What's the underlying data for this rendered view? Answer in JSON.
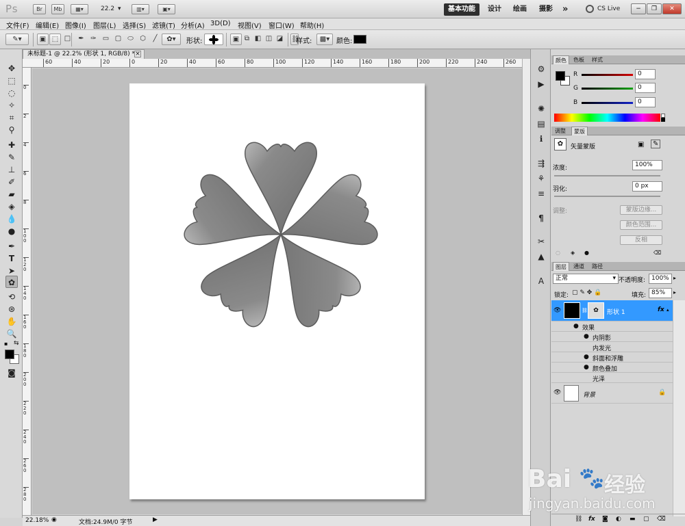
{
  "app": {
    "logo": "Ps",
    "br": "Br",
    "mb": "Mb",
    "zoom": "22.2"
  },
  "workspaces": {
    "active": "基本功能",
    "items": [
      "设计",
      "绘画",
      "摄影"
    ],
    "more": "»",
    "cslive": "CS Live"
  },
  "menu": [
    "文件(F)",
    "编辑(E)",
    "图像(I)",
    "图层(L)",
    "选择(S)",
    "滤镜(T)",
    "分析(A)",
    "3D(D)",
    "视图(V)",
    "窗口(W)",
    "帮助(H)"
  ],
  "options": {
    "shape_label": "形状:",
    "style_label": "样式:",
    "color_label": "颜色:",
    "color_value": "#000000"
  },
  "document": {
    "tab_title": "未标题-1 @ 22.2% (形状 1, RGB/8) *",
    "ruler_h": [
      "60",
      "40",
      "20",
      "0",
      "20",
      "40",
      "60",
      "80",
      "100",
      "120",
      "140",
      "160",
      "180",
      "200",
      "220",
      "240",
      "260"
    ],
    "ruler_v": [
      "0",
      "2",
      "4",
      "6",
      "8",
      "100",
      "120",
      "140",
      "160",
      "180",
      "200",
      "220",
      "240",
      "260",
      "280",
      "300"
    ],
    "zoom_status": "22.18%",
    "doc_status": "文档:24.9M/0 字节"
  },
  "color_panel": {
    "tabs": [
      "颜色",
      "色板",
      "样式"
    ],
    "channels": [
      {
        "label": "R",
        "value": "0",
        "color": "#d40000"
      },
      {
        "label": "G",
        "value": "0",
        "color": "#12a312"
      },
      {
        "label": "B",
        "value": "0",
        "color": "#1222c8"
      }
    ]
  },
  "mask_panel": {
    "tabs": [
      "调整",
      "蒙版"
    ],
    "title": "矢量蒙版",
    "density_label": "浓度:",
    "density_value": "100%",
    "feather_label": "羽化:",
    "feather_value": "0 px",
    "adjust_label": "调整:",
    "buttons": [
      "蒙版边缘...",
      "颜色范围...",
      "反相"
    ]
  },
  "layers_panel": {
    "tabs": [
      "图层",
      "通道",
      "路径"
    ],
    "blend_mode": "正常",
    "opacity_label": "不透明度:",
    "opacity_value": "100%",
    "lock_label": "锁定:",
    "fill_label": "填充:",
    "fill_value": "85%",
    "layers": [
      {
        "name": "形状 1",
        "fx": "fx"
      },
      {
        "name": "背景"
      }
    ],
    "effects_label": "效果",
    "effects": [
      {
        "name": "内阴影",
        "visible": true
      },
      {
        "name": "内发光",
        "visible": false
      },
      {
        "name": "斜面和浮雕",
        "visible": true
      },
      {
        "name": "颜色叠加",
        "visible": true
      },
      {
        "name": "光泽",
        "visible": false
      }
    ]
  },
  "watermark": {
    "brand": "Bai",
    "cn": "经验",
    "url": "jingyan.baidu.com"
  },
  "colors": {
    "accent": "#3399ff",
    "shape_gray": "#7d7d7d",
    "canvas_bg": "#bfbfbf"
  }
}
